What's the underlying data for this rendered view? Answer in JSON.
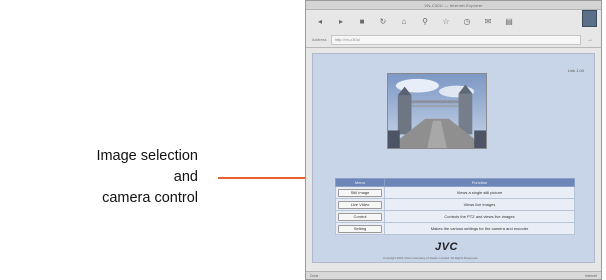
{
  "annotation": {
    "line1": "Image selection and",
    "line2": "camera control",
    "accent_color": "#e5622c"
  },
  "browser": {
    "title": "VN-C30U — Internet Explorer",
    "toolbar_icons": [
      "back-icon",
      "forward-icon",
      "stop-icon",
      "refresh-icon",
      "home-icon",
      "search-icon",
      "favorites-icon",
      "history-icon",
      "mail-icon",
      "print-icon"
    ],
    "address_label": "Address",
    "address_value": "http://vn-c30u/",
    "go_glyph": "→"
  },
  "page": {
    "corner_link": "Link 1.00",
    "photo_subject": "tower-bridge",
    "table_header_left": "Menu",
    "table_header_right": "Function",
    "rows": [
      {
        "button": "Still Image",
        "description": "Views a single still picture"
      },
      {
        "button": "Live Video",
        "description": "Views live images"
      },
      {
        "button": "Control",
        "description": "Controls the PTZ and views live images"
      },
      {
        "button": "Setting",
        "description": "Makes the various settings for the camera and encoder"
      }
    ],
    "logo": "JVC",
    "footer": "Copyright 2001 Victor Company of Japan, Limited. All Rights Reserved."
  },
  "status": {
    "left": "Done",
    "right": "Internet"
  },
  "colors": {
    "page_bg": "#c8d4e8",
    "table_header": "#6c86b8",
    "throbber": "#5b6f88"
  }
}
